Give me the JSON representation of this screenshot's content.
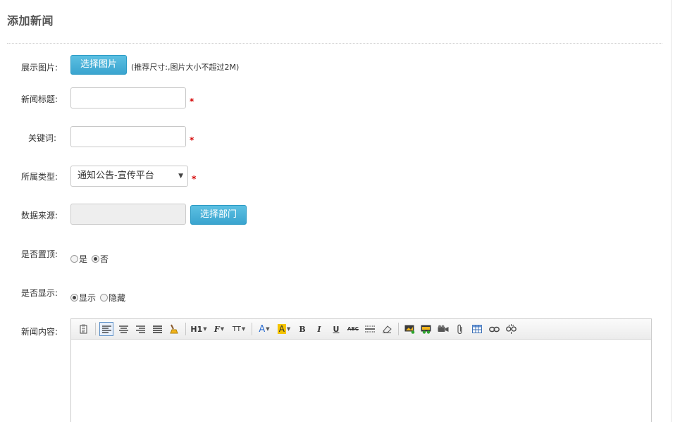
{
  "page": {
    "title": "添加新闻"
  },
  "form": {
    "image": {
      "label": "展示图片:",
      "button": "选择图片",
      "hint": "(推荐尺寸:,图片大小不超过2M)"
    },
    "title": {
      "label": "新闻标题:",
      "value": "",
      "required": "*"
    },
    "keywords": {
      "label": "关键词:",
      "value": "",
      "required": "*"
    },
    "type": {
      "label": "所属类型:",
      "selected": "通知公告-宣传平台",
      "required": "*"
    },
    "source": {
      "label": "数据来源:",
      "value": "",
      "button": "选择部门"
    },
    "pin": {
      "label": "是否置顶:",
      "options": [
        "是",
        "否"
      ],
      "selected": "否"
    },
    "display": {
      "label": "是否显示:",
      "options": [
        "显示",
        "隐藏"
      ],
      "selected": "显示"
    },
    "content": {
      "label": "新闻内容:"
    }
  },
  "editor": {
    "toolbar": {
      "heading": "H1",
      "font": "F",
      "fontsize": "TT",
      "forecolor": "A",
      "backcolor": "A",
      "bold": "B",
      "italic": "I",
      "underline": "U",
      "strike": "ABC",
      "accent_color": "#f5c400",
      "fore_color": "#2f6fd1"
    }
  }
}
